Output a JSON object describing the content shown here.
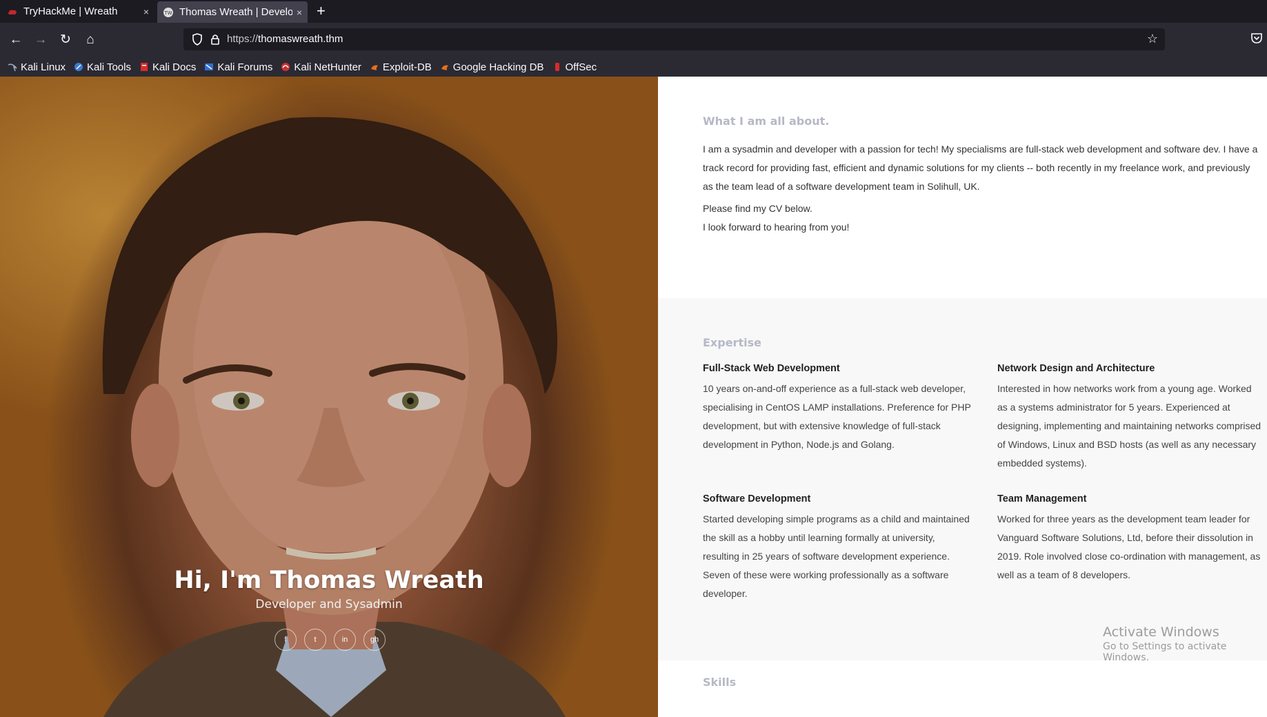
{
  "tabs": [
    {
      "title": "TryHackMe | Wreath",
      "close": "×"
    },
    {
      "title": "Thomas Wreath | Develop",
      "close": "×"
    }
  ],
  "new_tab": "+",
  "nav": {
    "back": "←",
    "forward": "→",
    "reload": "↻",
    "home": "⌂",
    "url_scheme": "https://",
    "url_host": "thomaswreath.thm",
    "star": "☆"
  },
  "bookmarks": [
    {
      "label": "Kali Linux",
      "icon": "kali-icon"
    },
    {
      "label": "Kali Tools",
      "icon": "kali-tools-icon"
    },
    {
      "label": "Kali Docs",
      "icon": "kali-docs-icon"
    },
    {
      "label": "Kali Forums",
      "icon": "kali-forums-icon"
    },
    {
      "label": "Kali NetHunter",
      "icon": "nethunter-icon"
    },
    {
      "label": "Exploit-DB",
      "icon": "exploitdb-icon"
    },
    {
      "label": "Google Hacking DB",
      "icon": "ghdb-icon"
    },
    {
      "label": "OffSec",
      "icon": "offsec-icon"
    }
  ],
  "hero": {
    "title": "Hi, I'm Thomas Wreath",
    "subtitle": "Developer and Sysadmin",
    "socials": [
      {
        "glyph": "f",
        "icon": "facebook-icon"
      },
      {
        "glyph": "t",
        "icon": "twitter-icon"
      },
      {
        "glyph": "in",
        "icon": "linkedin-icon"
      },
      {
        "glyph": "gh",
        "icon": "github-icon"
      }
    ]
  },
  "about": {
    "title": "What I am all about.",
    "p1_lines": [
      "I am a sysadmin and developer with a passion for tech! My specialisms are full-stack web development and software dev. I have a",
      "track record for providing fast, efficient and dynamic solutions for my clients -- both recently in my freelance work, and previously",
      "as the team lead of a software development team in Solihull, UK."
    ],
    "p2_lines": [
      "Please find my CV below.",
      "I look forward to hearing from you!"
    ]
  },
  "expertise": {
    "title": "Expertise",
    "items": [
      {
        "heading": "Full-Stack Web Development",
        "lines": [
          "10 years on-and-off experience as a full-stack web developer,",
          "specialising in CentOS LAMP installations. Preference for PHP",
          "development, but with extensive knowledge of full-stack",
          "development in Python, Node.js and Golang."
        ]
      },
      {
        "heading": "Network Design and Architecture",
        "lines": [
          "Interested in how networks work from a young age. Worked",
          "as a systems administrator for 5 years. Experienced at",
          "designing, implementing and maintaining networks comprised",
          "of Windows, Linux and BSD hosts (as well as any necessary",
          "embedded systems)."
        ]
      },
      {
        "heading": "Software Development",
        "lines": [
          "Started developing simple programs as a child and maintained",
          "the skill as a hobby until learning formally at university,",
          "resulting in 25 years of software development experience.",
          "Seven of these were working professionally as a software",
          "developer."
        ]
      },
      {
        "heading": "Team Management",
        "lines": [
          "Worked for three years as the development team leader for",
          "Vanguard Software Solutions, Ltd, before their dissolution in",
          "2019. Role involved close co-ordination with management, as",
          "well as a team of 8 developers."
        ]
      }
    ]
  },
  "skills": {
    "title": "Skills"
  },
  "watermark": {
    "line1": "Activate Windows",
    "line2": "Go to Settings to activate Windows."
  }
}
